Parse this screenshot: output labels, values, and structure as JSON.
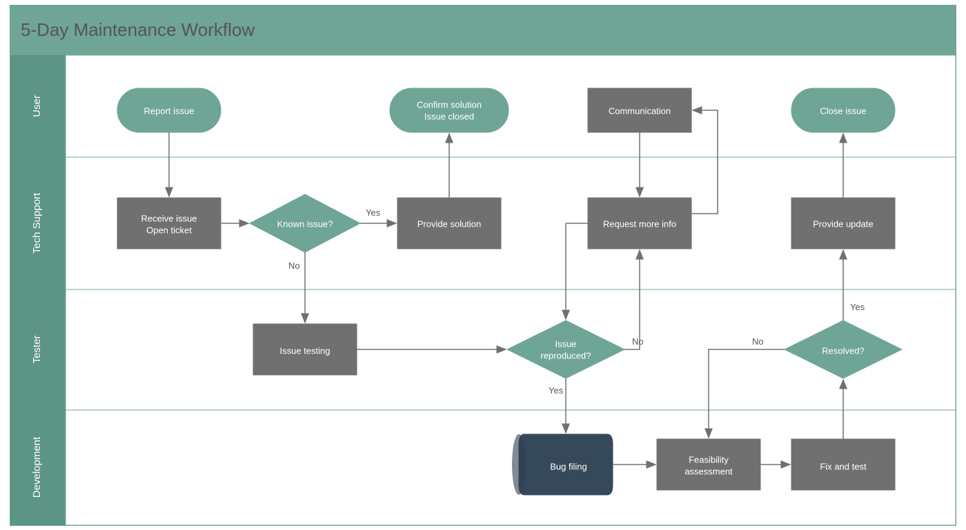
{
  "title": "5-Day Maintenance Workflow",
  "lanes": {
    "user": "User",
    "tech_support": "Tech Support",
    "tester": "Tester",
    "development": "Development"
  },
  "nodes": {
    "report_issue": "Report issue",
    "confirm_solution_l1": "Confirm solution",
    "confirm_solution_l2": "Issue closed",
    "communication": "Communication",
    "close_issue": "Close issue",
    "receive_issue_l1": "Receive issue",
    "receive_issue_l2": "Open ticket",
    "known_issue": "Known issue?",
    "provide_solution": "Provide solution",
    "request_more_info": "Request more info",
    "provide_update": "Provide update",
    "issue_testing": "Issue testing",
    "issue_reproduced_l1": "Issue",
    "issue_reproduced_l2": "reproduced?",
    "resolved": "Resolved?",
    "bug_filing": "Bug filing",
    "feasibility_l1": "Feasibility",
    "feasibility_l2": "assessment",
    "fix_and_test": "Fix and test"
  },
  "labels": {
    "yes": "Yes",
    "no": "No"
  },
  "colors": {
    "teal": "#6fa596",
    "teal_dark": "#5c9485",
    "grey": "#707070",
    "navy": "#36495b"
  }
}
